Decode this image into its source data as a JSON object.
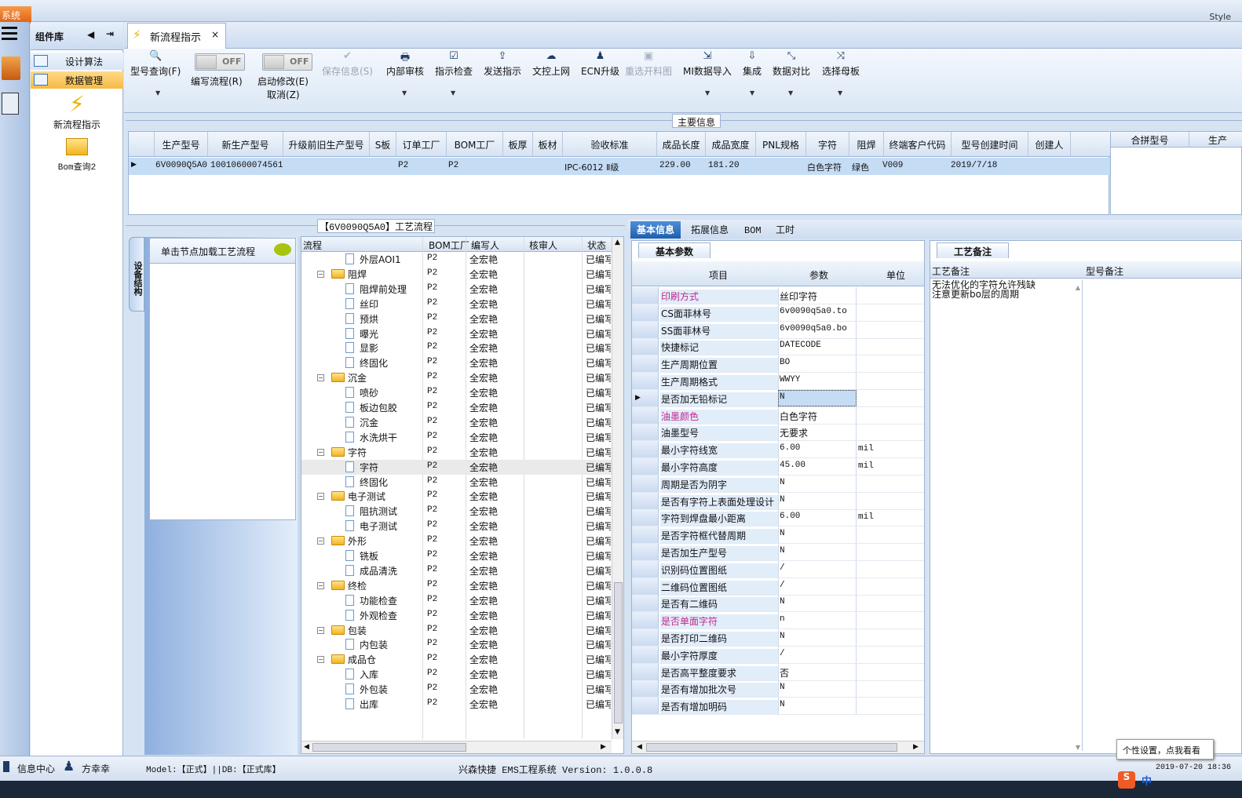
{
  "app": {
    "system_tab": "系统",
    "style_label": "Style"
  },
  "complib": {
    "title": "组件库",
    "items": [
      {
        "label": "设计算法"
      },
      {
        "label": "数据管理"
      }
    ],
    "tools": [
      {
        "label": "新流程指示"
      },
      {
        "label": "Bom查询2"
      }
    ]
  },
  "tabs": {
    "active": "新流程指示"
  },
  "toolbar": {
    "query": "型号查询(F)",
    "toggle1": {
      "state": "OFF",
      "label": "编写流程(R)"
    },
    "toggle2": {
      "state": "OFF",
      "label": "启动修改(E)",
      "sub": "取消(Z)"
    },
    "save": "保存信息(S)",
    "internal_review": "内部审核",
    "instr_check": "指示检查",
    "send": "发送指示",
    "doc_upload": "文控上网",
    "ecn": "ECN升级",
    "reselect": "重选开料图",
    "mi_import": "MI数据导入",
    "integrate": "集成",
    "compare": "数据对比",
    "mother_board": "选择母板"
  },
  "main_info": {
    "title": "主要信息",
    "columns": [
      "生产型号",
      "新生产型号",
      "升级前旧生产型号",
      "S板",
      "订单工厂",
      "BOM工厂",
      "板厚",
      "板材",
      "验收标准",
      "成品长度",
      "成品宽度",
      "PNL规格",
      "字符",
      "阻焊",
      "终端客户代码",
      "型号创建时间",
      "创建人"
    ],
    "row": {
      "prod_model": "6V0090Q5A0",
      "new_model": "10010600074561",
      "order_factory": "P2",
      "bom_factory": "P2",
      "standard": "IPC-6012 Ⅱ级",
      "length": "229.00",
      "width": "181.20",
      "char": "白色字符",
      "mask": "绿色",
      "client": "V009",
      "created": "2019/7/18"
    },
    "merge_cols": [
      "合拼型号",
      "生产"
    ]
  },
  "flow": {
    "title": "【6V0090Q5A0】工艺流程",
    "side_tab": "设备结构",
    "click_hint": "单击节点加载工艺流程",
    "headers": {
      "flow": "流程",
      "bom": "BOM工厂",
      "writer": "编写人",
      "reviewer": "核审人",
      "status": "状态"
    },
    "rows": [
      {
        "name": "外层AOI1",
        "folder": false,
        "bom": "P2",
        "writer": "全宏艳",
        "status": "已编写"
      },
      {
        "name": "阻焊",
        "folder": true,
        "bom": "P2",
        "writer": "全宏艳",
        "status": "已编写"
      },
      {
        "name": "阻焊前处理",
        "folder": false,
        "bom": "P2",
        "writer": "全宏艳",
        "status": "已编写"
      },
      {
        "name": "丝印",
        "folder": false,
        "bom": "P2",
        "writer": "全宏艳",
        "status": "已编写"
      },
      {
        "name": "预烘",
        "folder": false,
        "bom": "P2",
        "writer": "全宏艳",
        "status": "已编写"
      },
      {
        "name": "曝光",
        "folder": false,
        "bom": "P2",
        "writer": "全宏艳",
        "status": "已编写"
      },
      {
        "name": "显影",
        "folder": false,
        "bom": "P2",
        "writer": "全宏艳",
        "status": "已编写"
      },
      {
        "name": "终固化",
        "folder": false,
        "bom": "P2",
        "writer": "全宏艳",
        "status": "已编写"
      },
      {
        "name": "沉金",
        "folder": true,
        "bom": "P2",
        "writer": "全宏艳",
        "status": "已编写"
      },
      {
        "name": "喷砂",
        "folder": false,
        "bom": "P2",
        "writer": "全宏艳",
        "status": "已编写"
      },
      {
        "name": "板边包胶",
        "folder": false,
        "bom": "P2",
        "writer": "全宏艳",
        "status": "已编写"
      },
      {
        "name": "沉金",
        "folder": false,
        "bom": "P2",
        "writer": "全宏艳",
        "status": "已编写"
      },
      {
        "name": "水洗烘干",
        "folder": false,
        "bom": "P2",
        "writer": "全宏艳",
        "status": "已编写"
      },
      {
        "name": "字符",
        "folder": true,
        "bom": "P2",
        "writer": "全宏艳",
        "status": "已编写"
      },
      {
        "name": "字符",
        "folder": false,
        "bom": "P2",
        "writer": "全宏艳",
        "status": "已编写"
      },
      {
        "name": "终固化",
        "folder": false,
        "bom": "P2",
        "writer": "全宏艳",
        "status": "已编写"
      },
      {
        "name": "电子测试",
        "folder": true,
        "bom": "P2",
        "writer": "全宏艳",
        "status": "已编写"
      },
      {
        "name": "阻抗测试",
        "folder": false,
        "bom": "P2",
        "writer": "全宏艳",
        "status": "已编写"
      },
      {
        "name": "电子测试",
        "folder": false,
        "bom": "P2",
        "writer": "全宏艳",
        "status": "已编写"
      },
      {
        "name": "外形",
        "folder": true,
        "bom": "P2",
        "writer": "全宏艳",
        "status": "已编写"
      },
      {
        "name": "铣板",
        "folder": false,
        "bom": "P2",
        "writer": "全宏艳",
        "status": "已编写"
      },
      {
        "name": "成品清洗",
        "folder": false,
        "bom": "P2",
        "writer": "全宏艳",
        "status": "已编写"
      },
      {
        "name": "终检",
        "folder": true,
        "bom": "P2",
        "writer": "全宏艳",
        "status": "已编写"
      },
      {
        "name": "功能检查",
        "folder": false,
        "bom": "P2",
        "writer": "全宏艳",
        "status": "已编写"
      },
      {
        "name": "外观检查",
        "folder": false,
        "bom": "P2",
        "writer": "全宏艳",
        "status": "已编写"
      },
      {
        "name": "包装",
        "folder": true,
        "bom": "P2",
        "writer": "全宏艳",
        "status": "已编写"
      },
      {
        "name": "内包装",
        "folder": false,
        "bom": "P2",
        "writer": "全宏艳",
        "status": "已编写"
      },
      {
        "name": "成品仓",
        "folder": true,
        "bom": "P2",
        "writer": "全宏艳",
        "status": "已编写"
      },
      {
        "name": "入库",
        "folder": false,
        "bom": "P2",
        "writer": "全宏艳",
        "status": "已编写"
      },
      {
        "name": "外包装",
        "folder": false,
        "bom": "P2",
        "writer": "全宏艳",
        "status": "已编写"
      },
      {
        "name": "出库",
        "folder": false,
        "bom": "P2",
        "writer": "全宏艳",
        "status": "已编写"
      }
    ]
  },
  "right_tabs": [
    "基本信息",
    "拓展信息",
    "BOM",
    "工时"
  ],
  "basic": {
    "title": "基本参数",
    "headers": {
      "item": "项目",
      "param": "参数",
      "unit": "单位"
    },
    "rows": [
      {
        "name": "印刷方式",
        "value": "丝印字符",
        "unit": "",
        "pink": true
      },
      {
        "name": "CS面菲林号",
        "value": "6v0090q5a0.to",
        "unit": ""
      },
      {
        "name": "SS面菲林号",
        "value": "6v0090q5a0.bo",
        "unit": ""
      },
      {
        "name": "快捷标记",
        "value": "DATECODE",
        "unit": ""
      },
      {
        "name": "生产周期位置",
        "value": "BO",
        "unit": ""
      },
      {
        "name": "生产周期格式",
        "value": "WWYY",
        "unit": ""
      },
      {
        "name": "是否加无铅标记",
        "value": "N",
        "unit": "",
        "current": true
      },
      {
        "name": "油墨颜色",
        "value": "白色字符",
        "unit": "",
        "pink": true
      },
      {
        "name": "油墨型号",
        "value": "无要求",
        "unit": ""
      },
      {
        "name": "最小字符线宽",
        "value": "6.00",
        "unit": "mil"
      },
      {
        "name": "最小字符高度",
        "value": "45.00",
        "unit": "mil"
      },
      {
        "name": "周期是否为阴字",
        "value": "N",
        "unit": ""
      },
      {
        "name": "是否有字符上表面处理设计",
        "value": "N",
        "unit": ""
      },
      {
        "name": "字符到焊盘最小距离",
        "value": "6.00",
        "unit": "mil"
      },
      {
        "name": "是否字符框代替周期",
        "value": "N",
        "unit": ""
      },
      {
        "name": "是否加生产型号",
        "value": "N",
        "unit": ""
      },
      {
        "name": "识别码位置图纸",
        "value": "/",
        "unit": ""
      },
      {
        "name": "二维码位置图纸",
        "value": "/",
        "unit": ""
      },
      {
        "name": "是否有二维码",
        "value": "N",
        "unit": ""
      },
      {
        "name": "是否单面字符",
        "value": "n",
        "unit": "",
        "pink": true
      },
      {
        "name": "是否打印二维码",
        "value": "N",
        "unit": ""
      },
      {
        "name": "最小字符厚度",
        "value": "/",
        "unit": ""
      },
      {
        "name": "是否高平整度要求",
        "value": "否",
        "unit": ""
      },
      {
        "name": "是否有增加批次号",
        "value": "N",
        "unit": ""
      },
      {
        "name": "是否有增加明码",
        "value": "N",
        "unit": ""
      }
    ]
  },
  "notes": {
    "title": "工艺备注",
    "col1": "工艺备注",
    "col2": "型号备注",
    "text1": "无法优化的字符允许残缺",
    "text2": "注意更新bo层的周期"
  },
  "status": {
    "info_center": "信息中心",
    "user": "方幸幸",
    "model_db": "Model:【正式】||DB:【正式库】",
    "system": "兴森快捷 EMS工程系统 Version: 1.0.0.8",
    "datetime": "2019-07-20 18:36",
    "tooltip": "个性设置，点我看看",
    "ime": "中"
  },
  "colors": {
    "pink_label": "#c0288a",
    "selection": "#c5dcf5",
    "accent": "#1f5fb0"
  }
}
